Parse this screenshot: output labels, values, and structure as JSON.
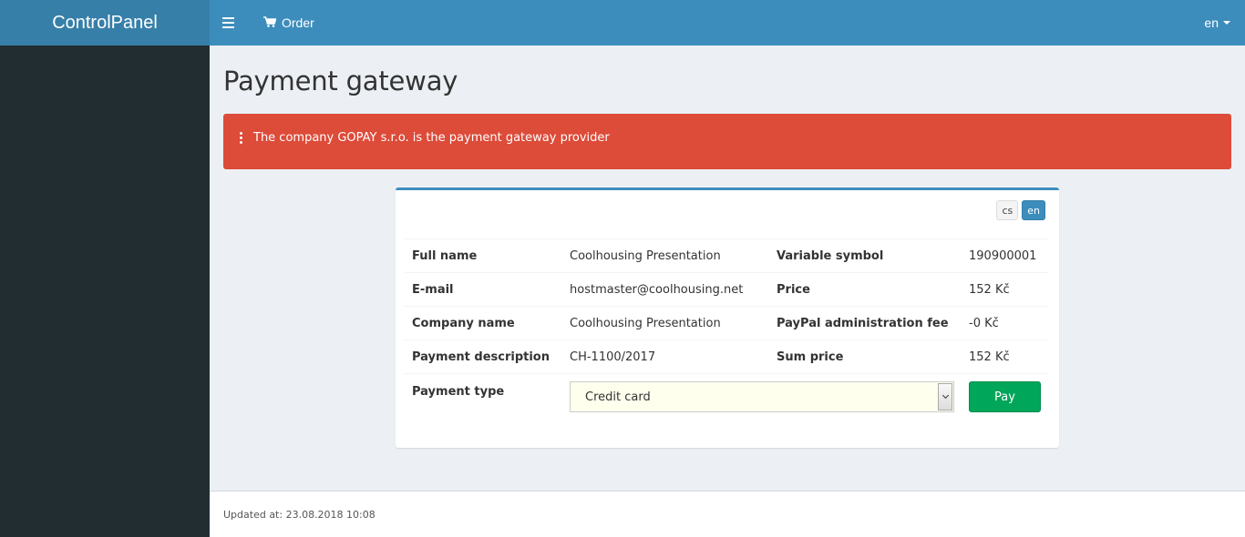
{
  "brand": {
    "title": "ControlPanel"
  },
  "topnav": {
    "order_label": "Order",
    "language": "en"
  },
  "page": {
    "title": "Payment gateway"
  },
  "alert": {
    "message": "The company GOPAY s.r.o. is the payment gateway provider"
  },
  "lang_switch": {
    "cs": "cs",
    "en": "en",
    "active": "en"
  },
  "details": {
    "rows": [
      {
        "label": "Full name",
        "value": "Coolhousing Presentation",
        "label2": "Variable symbol",
        "value2": "190900001"
      },
      {
        "label": "E-mail",
        "value": "hostmaster@coolhousing.net",
        "label2": "Price",
        "value2": "152 Kč"
      },
      {
        "label": "Company name",
        "value": "Coolhousing Presentation",
        "label2": "PayPal administration fee",
        "value2": "-0 Kč"
      },
      {
        "label": "Payment description",
        "value": "CH-1100/2017",
        "label2": "Sum price",
        "value2": "152 Kč"
      }
    ],
    "payment_type_label": "Payment type",
    "payment_type_selected": "Credit card",
    "pay_label": "Pay"
  },
  "footer": {
    "updated": "Updated at: 23.08.2018 10:08"
  },
  "colors": {
    "header": "#3c8dbc",
    "brand_bg": "#367fa9",
    "sidebar": "#222d32",
    "alert": "#dd4b39",
    "pay": "#00a65a",
    "select_bg": "#ffffee"
  },
  "icons": {
    "toggle": "bars-icon",
    "order": "shopping-cart-icon",
    "alert": "exclamation-icon"
  }
}
